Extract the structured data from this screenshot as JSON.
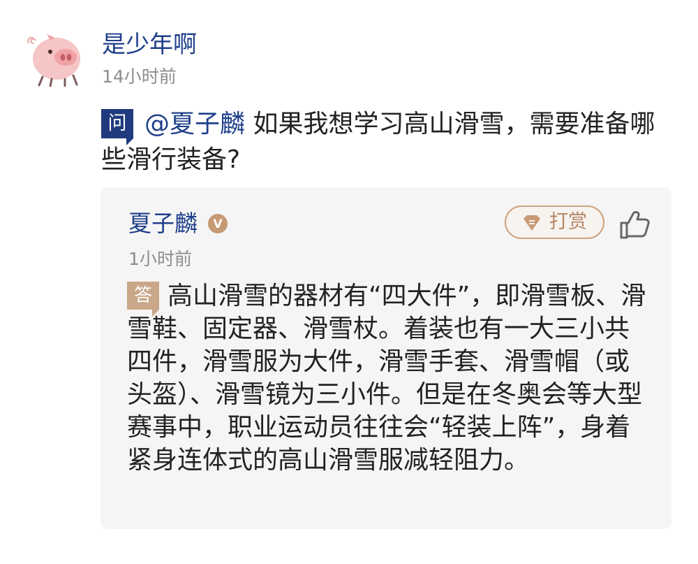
{
  "post": {
    "username": "是少年啊",
    "time": "14小时前",
    "question_tag": "问",
    "mention": "@夏子麟",
    "question_text": "如果我想学习高山滑雪，需要准备哪些滑行装备?"
  },
  "answer": {
    "name": "夏子麟",
    "verified_badge": "V",
    "reward_label": "打赏",
    "time": "1小时前",
    "answer_tag": "答",
    "text": "高山滑雪的器材有“四大件”，即滑雪板、滑雪鞋、固定器、滑雪杖。着装也有一大三小共四件，滑雪服为大件，滑雪手套、滑雪帽（或头盔）、滑雪镜为三小件。但是在冬奥会等大型赛事中，职业运动员往往会“轻装上阵”，身着紧身连体式的高山滑雪服减轻阻力。"
  },
  "icons": {
    "avatar": "pig-avatar-icon",
    "verified": "verified-badge-icon",
    "reward": "diamond-icon",
    "like": "thumbs-up-icon"
  },
  "colors": {
    "link_blue": "#1f3f8a",
    "question_tag_bg": "#1f3b7d",
    "answer_tag_bg": "#c9a788",
    "reward_border": "#cfa27c",
    "card_bg": "#f5f5f5"
  }
}
